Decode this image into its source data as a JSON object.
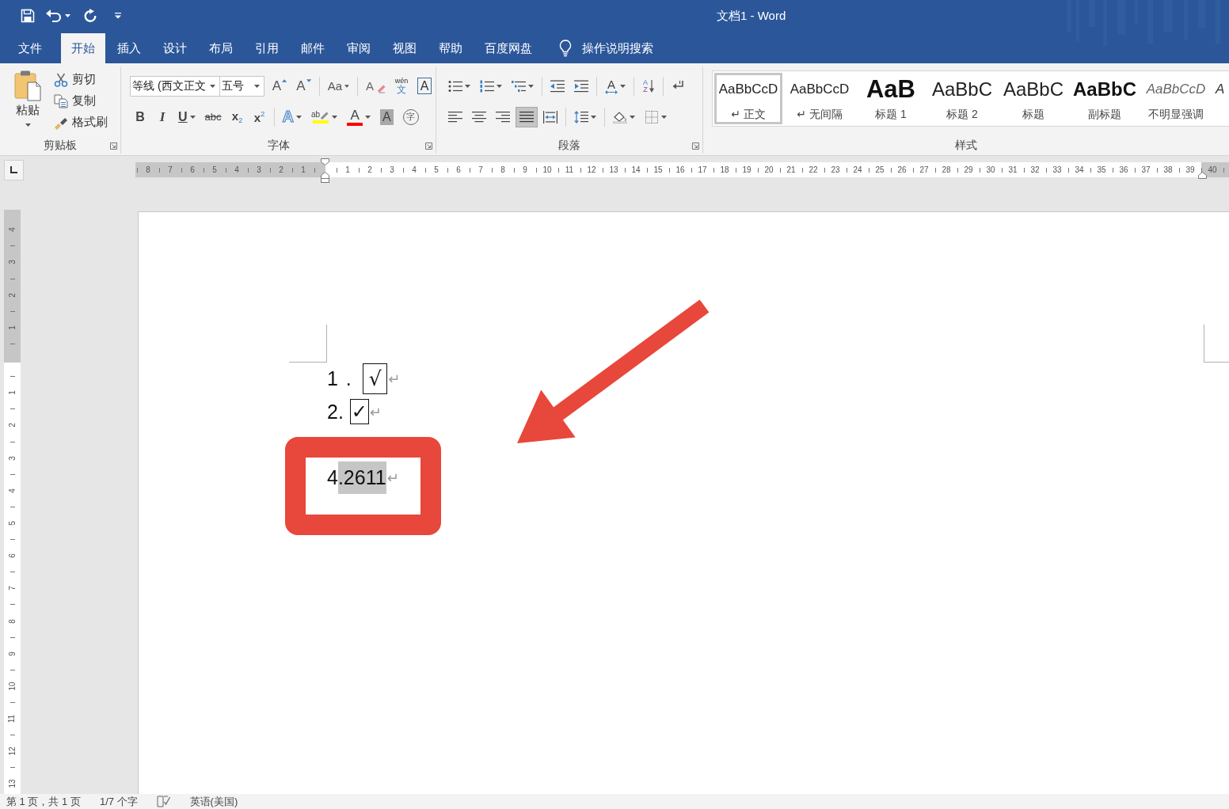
{
  "window": {
    "title": "文档1 - Word"
  },
  "tabs": [
    {
      "label": "文件",
      "selected": false
    },
    {
      "label": "开始",
      "selected": true
    },
    {
      "label": "插入",
      "selected": false
    },
    {
      "label": "设计",
      "selected": false
    },
    {
      "label": "布局",
      "selected": false
    },
    {
      "label": "引用",
      "selected": false
    },
    {
      "label": "邮件",
      "selected": false
    },
    {
      "label": "审阅",
      "selected": false
    },
    {
      "label": "视图",
      "selected": false
    },
    {
      "label": "帮助",
      "selected": false
    },
    {
      "label": "百度网盘",
      "selected": false
    }
  ],
  "tell_me": {
    "label": "操作说明搜索"
  },
  "clipboard": {
    "label": "剪贴板",
    "paste": "粘贴",
    "actions": [
      {
        "kind": "cut",
        "label": "剪切"
      },
      {
        "kind": "copy",
        "label": "复制"
      },
      {
        "kind": "format-painter",
        "label": "格式刷"
      }
    ]
  },
  "font": {
    "label": "字体",
    "font_name": "等线 (西文正文",
    "font_size": "五号",
    "tool_rows": [
      {
        "groups": [
          {
            "buttons": [
              {
                "kind": "grow",
                "glyph": "A",
                "dropdown": false
              },
              {
                "kind": "shrink",
                "glyph": "A",
                "dropdown": false
              }
            ]
          },
          {
            "buttons": [
              {
                "kind": "case",
                "glyph": "Aa",
                "dropdown": true
              }
            ]
          },
          {
            "buttons": [
              {
                "kind": "clear",
                "glyph": "A",
                "dropdown": false
              },
              {
                "kind": "phonetic",
                "glyph": "wén",
                "sub": "文",
                "dropdown": false
              },
              {
                "kind": "border",
                "glyph": "A",
                "dropdown": false
              }
            ]
          }
        ]
      },
      {
        "groups": [
          {
            "buttons": [
              {
                "kind": "bold",
                "glyph": "B",
                "dropdown": false
              },
              {
                "kind": "italic",
                "glyph": "I",
                "dropdown": false
              },
              {
                "kind": "underline",
                "glyph": "U",
                "dropdown": true
              },
              {
                "kind": "strike",
                "glyph": "abc",
                "dropdown": false
              },
              {
                "kind": "subscript",
                "glyph": "x",
                "sub": "2",
                "dropdown": false
              },
              {
                "kind": "superscript",
                "glyph": "x",
                "sub": "2",
                "dropdown": false
              }
            ]
          },
          {
            "buttons": [
              {
                "kind": "effects",
                "glyph": "A",
                "dropdown": true
              },
              {
                "kind": "highlight",
                "glyph": "ab",
                "color": "#ffff00",
                "dropdown": true
              },
              {
                "kind": "color",
                "glyph": "A",
                "color": "#ff0000",
                "dropdown": true
              },
              {
                "kind": "shading",
                "glyph": "A",
                "dropdown": false
              },
              {
                "kind": "enclose",
                "glyph": "字",
                "dropdown": false
              }
            ]
          }
        ]
      }
    ]
  },
  "paragraph": {
    "label": "段落",
    "tool_rows": [
      {
        "groups": [
          {
            "buttons": [
              {
                "kind": "bullets",
                "dropdown": true
              },
              {
                "kind": "numbering",
                "dropdown": true
              },
              {
                "kind": "multilevel",
                "dropdown": true
              }
            ]
          },
          {
            "buttons": [
              {
                "kind": "outdent",
                "dropdown": false
              },
              {
                "kind": "indent",
                "dropdown": false
              }
            ]
          },
          {
            "buttons": [
              {
                "kind": "asian-layout",
                "glyph": "A",
                "dropdown": true
              }
            ]
          },
          {
            "buttons": [
              {
                "kind": "sort",
                "glyph": "A",
                "sub": "Z",
                "dropdown": false
              }
            ]
          },
          {
            "buttons": [
              {
                "kind": "show-marks",
                "dropdown": false
              }
            ]
          }
        ]
      },
      {
        "groups": [
          {
            "buttons": [
              {
                "kind": "align-left",
                "selected": false,
                "dropdown": false
              },
              {
                "kind": "align-center",
                "selected": false,
                "dropdown": false
              },
              {
                "kind": "align-right",
                "selected": false,
                "dropdown": false
              },
              {
                "kind": "justify",
                "selected": true,
                "dropdown": false
              },
              {
                "kind": "distributed",
                "selected": false,
                "dropdown": false
              }
            ]
          },
          {
            "buttons": [
              {
                "kind": "line-spacing",
                "dropdown": true
              }
            ]
          },
          {
            "buttons": [
              {
                "kind": "shading",
                "dropdown": true
              },
              {
                "kind": "borders",
                "dropdown": true
              }
            ]
          }
        ]
      }
    ]
  },
  "styles": {
    "label": "样式",
    "items": [
      {
        "kind": "normal",
        "preview": "AaBbCcD",
        "name": "↵ 正文",
        "selected": true
      },
      {
        "kind": "no-spacing",
        "preview": "AaBbCcD",
        "name": "↵ 无间隔",
        "selected": false
      },
      {
        "kind": "heading-1",
        "preview": "AaB",
        "name": "标题 1",
        "selected": false
      },
      {
        "kind": "heading-2",
        "preview": "AaBbC",
        "name": "标题 2",
        "selected": false
      },
      {
        "kind": "title",
        "preview": "AaBbC",
        "name": "标题",
        "selected": false
      },
      {
        "kind": "subtitle",
        "preview": "AaBbC",
        "name": "副标题",
        "selected": false
      },
      {
        "kind": "subtle-emphasis",
        "preview": "AaBbCcD",
        "name": "不明显强调",
        "selected": false
      },
      {
        "kind": "emphasis",
        "preview": "A",
        "selected": false
      }
    ]
  },
  "horizontal_ruler": {
    "left_numbers": [
      "8",
      "7",
      "6",
      "5",
      "4",
      "3",
      "2",
      "1"
    ],
    "numbers": [
      "1",
      "2",
      "3",
      "4",
      "5",
      "6",
      "7",
      "8",
      "9",
      "10",
      "11",
      "12",
      "13",
      "14",
      "15",
      "16",
      "17",
      "18",
      "19",
      "20",
      "21",
      "22",
      "23",
      "24",
      "25",
      "26",
      "27",
      "28",
      "29",
      "30",
      "31",
      "32",
      "33",
      "34",
      "35",
      "36",
      "37",
      "38",
      "39",
      "40"
    ]
  },
  "vertical_ruler": {
    "top_numbers": [
      "4",
      "3",
      "2",
      "1"
    ],
    "numbers": [
      "1",
      "2",
      "3",
      "4",
      "5",
      "6",
      "7",
      "8",
      "9",
      "10",
      "11",
      "12",
      "13"
    ]
  },
  "document": {
    "lines": [
      {
        "kind": "large-box",
        "number": "1 .",
        "text": "√",
        "mark": "↵",
        "selected": false
      },
      {
        "kind": "small-box",
        "number": "2.",
        "text": "✓",
        "mark": "↵",
        "selected": false
      },
      {
        "kind": "plain",
        "number": "4",
        "text": ".2611",
        "mark": "↵",
        "selected": true
      }
    ]
  },
  "status_bar": {
    "page": "第 1 页，共 1 页",
    "words": "1/7 个字",
    "language": "英语(美国)"
  }
}
